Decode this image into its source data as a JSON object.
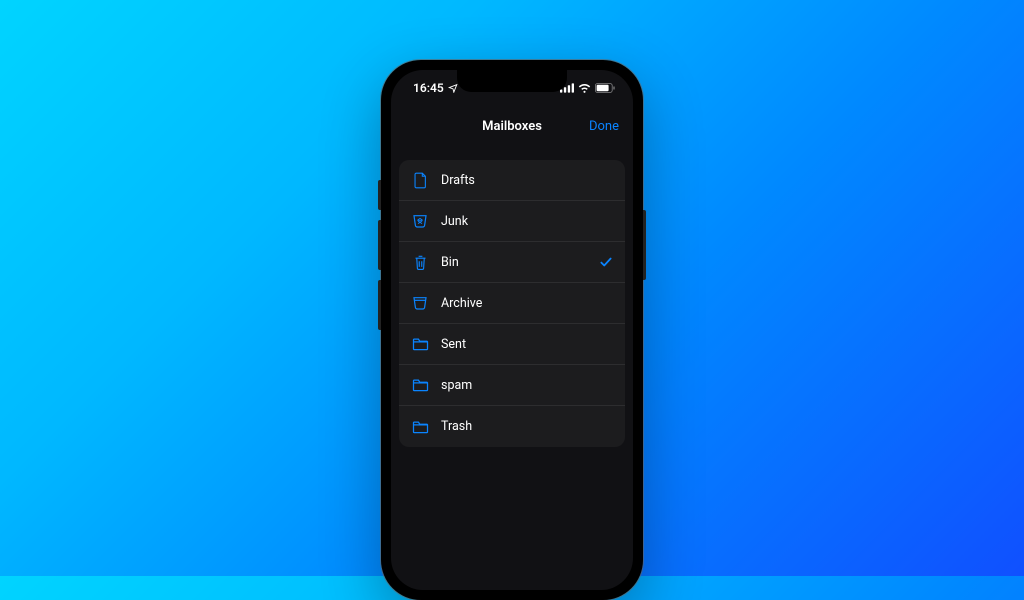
{
  "status": {
    "time": "16:45"
  },
  "nav": {
    "title": "Mailboxes",
    "done": "Done"
  },
  "mailboxes": {
    "items": [
      {
        "label": "Drafts",
        "icon": "document-icon",
        "selected": false
      },
      {
        "label": "Junk",
        "icon": "junk-icon",
        "selected": false
      },
      {
        "label": "Bin",
        "icon": "trash-icon",
        "selected": true
      },
      {
        "label": "Archive",
        "icon": "archive-icon",
        "selected": false
      },
      {
        "label": "Sent",
        "icon": "folder-icon",
        "selected": false
      },
      {
        "label": "spam",
        "icon": "folder-icon",
        "selected": false
      },
      {
        "label": "Trash",
        "icon": "folder-icon",
        "selected": false
      }
    ]
  },
  "colors": {
    "accent": "#0a84ff",
    "listBg": "#1c1c1e",
    "screenBg": "#111114"
  }
}
